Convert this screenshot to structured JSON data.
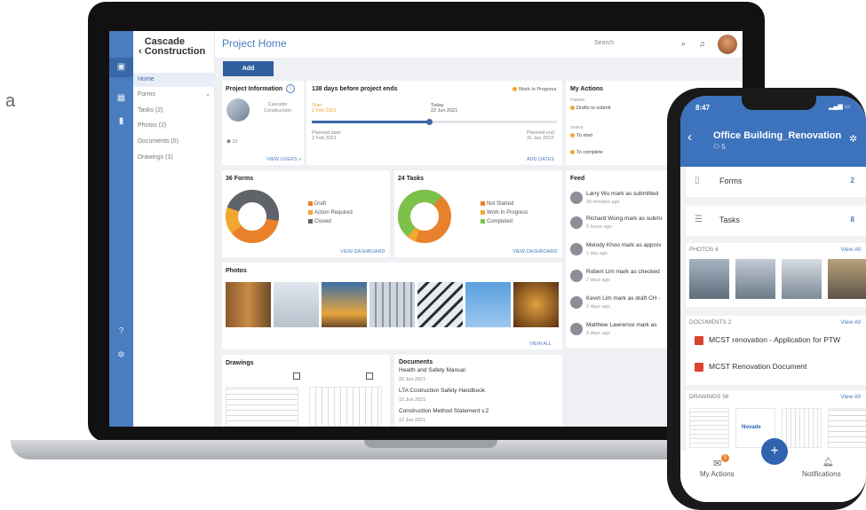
{
  "outside_text": "a",
  "laptop": {
    "back_label": "Cascade Construction",
    "nav": [
      "Home",
      "Forms",
      "Tasks (2)",
      "Photos (2)",
      "Documents (0)",
      "Drawings (1)"
    ],
    "page_title": "Project Home",
    "search_placeholder": "Search",
    "add_label": "Add",
    "project_info": {
      "title": "Project Information",
      "name": "Cascade Construction",
      "count": "32",
      "link": "VIEW USERS >"
    },
    "timeline": {
      "title": "138 days before project ends",
      "status": "Work In Progress",
      "start_label": "Start",
      "start_date": "2 Feb 2021",
      "today_label": "Today",
      "today_date": "22 Jun 2021",
      "planned_start_label": "Planned start",
      "planned_start_date": "2 Feb 2021",
      "planned_end_label": "Planned end",
      "planned_end_date": "31 Jan 2022",
      "link": "ADD DATES",
      "progress": 0.48
    },
    "actions": {
      "title": "My Actions",
      "forms_label": "FORMS",
      "drafts": "Drafts to submit",
      "tasks_label": "TASKS",
      "to_start": "To start",
      "to_complete": "To complete"
    },
    "forms_chart": {
      "title": "36 Forms",
      "legend": [
        "Draft",
        "Action Required",
        "Closed"
      ],
      "link": "VIEW DASHBOARD"
    },
    "tasks_chart": {
      "title": "24 Tasks",
      "legend": [
        "Not Started",
        "Work In Progress",
        "Completed"
      ],
      "link": "VIEW DASHBOARD"
    },
    "feed": {
      "title": "Feed",
      "items": [
        {
          "text": "Larry Wu  mark as submitted",
          "time": "30 minutes ago"
        },
        {
          "text": "Richard Wong mark as submi",
          "time": "5 hours ago"
        },
        {
          "text": "Melody Khoo mark as approv",
          "time": "1 day ago"
        },
        {
          "text": "Robert Lim mark as checked",
          "time": "2 days ago"
        },
        {
          "text": "Kevin Lim mark as draft CH -",
          "time": "2 days ago"
        },
        {
          "text": "Matthew Lawrence mark as",
          "time": "3 days ago"
        }
      ]
    },
    "photos": {
      "title": "Photos",
      "link": "VIEW ALL"
    },
    "drawings": {
      "title": "Drawings"
    },
    "documents": {
      "title": "Documents",
      "items": [
        {
          "name": "Health and Safety Manual",
          "date": "20 Jun 2021"
        },
        {
          "name": "LTA Costruction Safety Handbook",
          "date": "15 Jun 2021"
        },
        {
          "name": "Construction Method Statement v.2",
          "date": "12 Jun 2021"
        }
      ]
    }
  },
  "phone": {
    "time": "8:47",
    "title": "Office Building_Renovation",
    "users": "5",
    "forms_label": "Forms",
    "forms_count": "2",
    "tasks_label": "Tasks",
    "tasks_count": "8",
    "photos_header": "PHOTOS  6",
    "view_all": "View All",
    "documents_header": "DOCUMENTS  2",
    "docs": [
      "MCST renovation - Application for PTW",
      "MCST Renovation Document"
    ],
    "drawings_header": "DRAWINGS  56",
    "drawing_logo": "Novade",
    "my_actions": "My Actions",
    "my_actions_badge": "1",
    "notifications": "Notifications"
  },
  "colors": {
    "brand": "#4a7cc0",
    "draft": "#e9812c",
    "action_required": "#f0a830",
    "closed": "#5f646b",
    "not_started": "#e9812c",
    "completed": "#7cc14a"
  }
}
